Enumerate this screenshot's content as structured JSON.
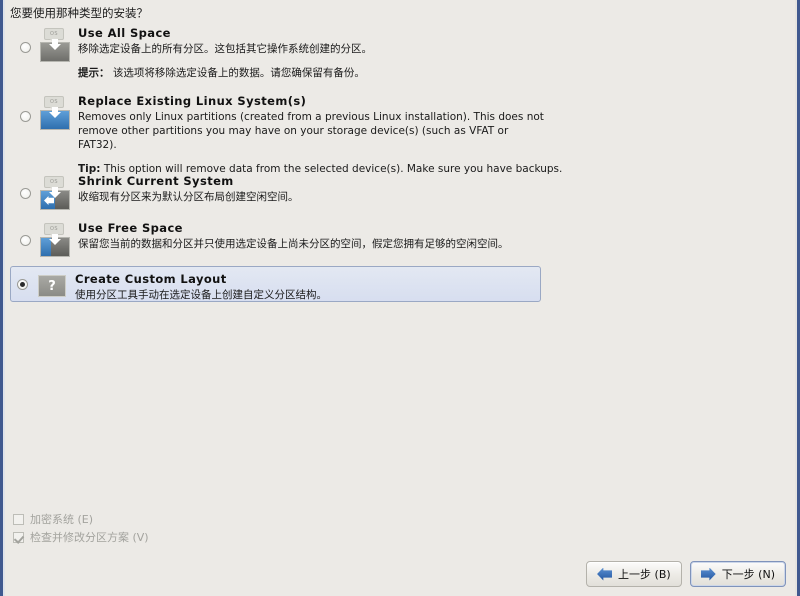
{
  "window": {
    "question": "您要使用那种类型的安装？"
  },
  "options": [
    {
      "title": "Use All Space",
      "desc": "移除选定设备上的所有分区。这包括其它操作系统创建的分区。",
      "tip_label": "提示：",
      "tip": "该选项将移除选定设备上的数据。请您确保留有备份。",
      "icon": "disk-erase-all-icon",
      "selected": false
    },
    {
      "title": "Replace Existing Linux System(s)",
      "desc": "Removes only Linux partitions (created from a previous Linux installation).  This does not remove other partitions you may have on your storage device(s) (such as VFAT or FAT32).",
      "tip_label": "Tip:",
      "tip": "This option will remove data from the selected device(s).  Make sure you have backups.",
      "icon": "disk-replace-linux-icon",
      "selected": false
    },
    {
      "title": "Shrink Current System",
      "desc": "收缩现有分区来为默认分区布局创建空闲空间。",
      "tip_label": "",
      "tip": "",
      "icon": "disk-shrink-icon",
      "selected": false
    },
    {
      "title": "Use Free Space",
      "desc": "保留您当前的数据和分区并只使用选定设备上尚未分区的空间，假定您拥有足够的空闲空间。",
      "tip_label": "",
      "tip": "",
      "icon": "disk-free-space-icon",
      "selected": false
    },
    {
      "title": "Create Custom Layout",
      "desc": "使用分区工具手动在选定设备上创建自定义分区结构。",
      "tip_label": "",
      "tip": "",
      "icon": "question-mark-icon",
      "selected": true
    }
  ],
  "checkboxes": [
    {
      "label": "加密系统 (E)",
      "checked": false,
      "disabled": true
    },
    {
      "label": "检查并修改分区方案 (V)",
      "checked": true,
      "disabled": true
    }
  ],
  "buttons": {
    "back": "上一步 (B)",
    "next": "下一步 (N)"
  },
  "icon_labels": {
    "os": "OS",
    "question": "?"
  },
  "colors": {
    "window_border": "#40598f",
    "background": "#eceae6",
    "selection": "#d7def0",
    "arrow_blue": "#2255a0"
  }
}
